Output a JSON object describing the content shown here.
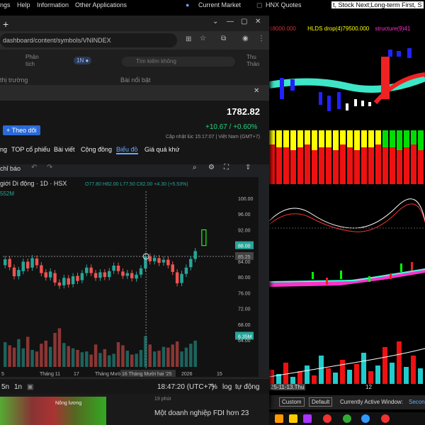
{
  "menubar": {
    "items": [
      "ngs",
      "Help",
      "Information",
      "Other Applications"
    ],
    "current_market": "Current Market",
    "hnx_quotes": "HNX Quotes",
    "ticker_text": "t, Stock Next;Long-term First, S"
  },
  "browser": {
    "url": "dashboard/content/symbols/VNINDEX",
    "tab_add": "+"
  },
  "site_nav": {
    "items": [
      "Phân tích",
      "Tìm kiếm không"
    ],
    "user": "Thu Thảo",
    "left_label": "thị trường",
    "right_label": "Bài nổi bật"
  },
  "quote": {
    "price": "1782.82",
    "change": "+10.67 / +0.60%",
    "updated": "Cập nhật lúc  15:17:07 | Việt Nam (GMT+7)",
    "follow_button": "+ Theo dõi"
  },
  "tabs": [
    "ng",
    "TOP cổ phiếu",
    "Bài viết",
    "Cộng đồng",
    "Biểu đồ",
    "Giá quá khứ"
  ],
  "active_tab": "Biểu đồ",
  "chart_toolbar": {
    "indicators": "chỉ báo"
  },
  "chart_header": {
    "symbol": "giới Di động · 1D · HSX",
    "ohlc": "O77.80 H82.00 L77.50 C82.00 +4.30 (+5.53%)",
    "volume": "552M"
  },
  "chart_data": {
    "type": "candlestick",
    "price_ticks": [
      "100.00",
      "96.00",
      "92.00",
      "88.00",
      "85.25",
      "84.00",
      "80.00",
      "76.00",
      "72.00",
      "68.00",
      "6.35M",
      "64.00"
    ],
    "x_ticks": [
      "5",
      "Tháng 11",
      "17",
      "Tháng Mười",
      "16 Tháng Mười hai '25",
      "2026",
      "15"
    ],
    "current_price_label": "88.00",
    "crosshair_label": "85.25",
    "volume_label": "6.35M",
    "candles": [
      {
        "o": 83.0,
        "c": 84.5
      },
      {
        "o": 84.6,
        "c": 82.5
      },
      {
        "o": 82.4,
        "c": 80.2
      },
      {
        "o": 80.2,
        "c": 81.8
      },
      {
        "o": 81.5,
        "c": 83.9
      },
      {
        "o": 83.9,
        "c": 82.2
      },
      {
        "o": 82.4,
        "c": 84.8
      },
      {
        "o": 84.7,
        "c": 83.0
      },
      {
        "o": 83.0,
        "c": 81.0
      },
      {
        "o": 81.2,
        "c": 79.9
      },
      {
        "o": 79.9,
        "c": 81.4
      },
      {
        "o": 81.0,
        "c": 78.6
      },
      {
        "o": 78.6,
        "c": 77.8
      },
      {
        "o": 77.9,
        "c": 79.8
      },
      {
        "o": 79.7,
        "c": 78.1
      },
      {
        "o": 78.2,
        "c": 80.2
      },
      {
        "o": 80.3,
        "c": 79.0
      },
      {
        "o": 79.2,
        "c": 81.0
      },
      {
        "o": 81.0,
        "c": 82.4
      },
      {
        "o": 82.4,
        "c": 81.0
      },
      {
        "o": 81.0,
        "c": 79.8
      },
      {
        "o": 79.8,
        "c": 81.2
      },
      {
        "o": 81.2,
        "c": 80.0
      },
      {
        "o": 80.0,
        "c": 81.5
      },
      {
        "o": 81.6,
        "c": 82.9
      },
      {
        "o": 82.9,
        "c": 81.5
      },
      {
        "o": 81.4,
        "c": 80.3
      },
      {
        "o": 80.3,
        "c": 81.0
      },
      {
        "o": 81.0,
        "c": 79.7
      },
      {
        "o": 79.6,
        "c": 80.6
      },
      {
        "o": 80.6,
        "c": 82.2
      },
      {
        "o": 82.2,
        "c": 85.3
      },
      {
        "o": 85.2,
        "c": 84.0
      },
      {
        "o": 84.0,
        "c": 84.9
      },
      {
        "o": 84.8,
        "c": 83.6
      },
      {
        "o": 83.7,
        "c": 84.4
      },
      {
        "o": 84.4,
        "c": 83.0
      },
      {
        "o": 83.2,
        "c": 81.3
      },
      {
        "o": 81.2,
        "c": 78.4
      },
      {
        "o": 78.5,
        "c": 80.8
      },
      {
        "o": 80.8,
        "c": 82.4
      },
      {
        "o": 82.5,
        "c": 84.6
      },
      {
        "o": 84.6,
        "c": 86.6
      }
    ],
    "volumes": [
      3.2,
      2.8,
      2.5,
      3.6,
      2.4,
      3.9,
      2.2,
      2.0,
      3.0,
      3.4,
      2.6,
      4.4,
      5.0,
      3.1,
      2.7,
      2.4,
      2.2,
      1.9,
      2.0,
      1.6,
      2.9,
      1.8,
      2.3,
      1.5,
      1.7,
      3.2,
      2.8,
      2.1,
      1.6,
      1.7,
      2.2,
      4.0,
      2.9,
      2.0,
      2.1,
      2.6,
      2.5,
      2.9,
      3.3,
      2.0,
      2.5,
      3.0,
      3.4
    ]
  },
  "bottom_bar": {
    "range_5n": "5n",
    "range_1n": "1n",
    "time": "18:47:20 (UTC+7)",
    "percent": "%",
    "log": "log",
    "auto": "tự động"
  },
  "article_strip": {
    "heatmap_label": "Nông lương",
    "time_label": "19 phút",
    "headline": "Một doanh nghiệp FDI hơn 23"
  },
  "right_app": {
    "header_left": "68000.000",
    "header_title": "HLDS drop(4)79500.000",
    "header_right": "structure(9)41",
    "date_label": "25-11-13.Thu",
    "axis_12": "12",
    "custom_btn": "Custom",
    "default_btn": "Default",
    "active_window": "Currently Active Window:",
    "second": "Secon"
  },
  "colors": {
    "up": "#26a69a",
    "down": "#ef5350",
    "accent": "#2a6ad8",
    "green_text": "#26d07c"
  }
}
